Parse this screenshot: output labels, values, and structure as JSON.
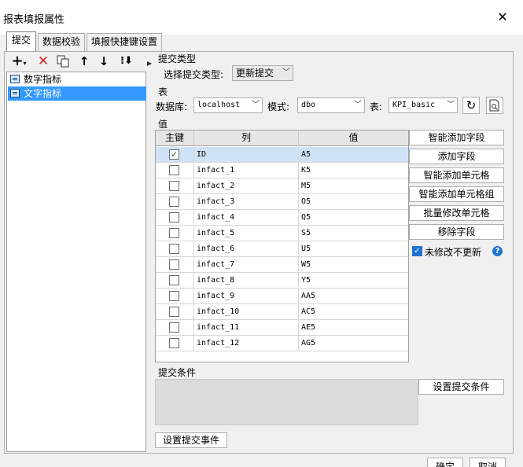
{
  "window": {
    "title": "报表填报属性"
  },
  "tabs": [
    {
      "label": "提交",
      "active": true
    },
    {
      "label": "数据校验",
      "active": false
    },
    {
      "label": "填报快捷键设置",
      "active": false
    }
  ],
  "left_toolbar": {
    "icons": [
      "add-icon",
      "delete-icon",
      "copy-icon",
      "move-up-icon",
      "move-down-icon",
      "sort-icon"
    ]
  },
  "tree": {
    "items": [
      {
        "label": "数字指标",
        "selected": false
      },
      {
        "label": "文字指标",
        "selected": true
      }
    ]
  },
  "submit_type": {
    "section_label": "提交类型",
    "field_label": "选择提交类型:",
    "value": "更新提交"
  },
  "table_section": {
    "section_label": "表",
    "db_label": "数据库:",
    "db_value": "localhost",
    "schema_label": "模式:",
    "schema_value": "dbo",
    "table_label": "表:",
    "table_value": "KPI_basic"
  },
  "value_section": {
    "section_label": "值",
    "headers": {
      "key": "主键",
      "column": "列",
      "value": "值"
    },
    "rows": [
      {
        "key": true,
        "column": "ID",
        "value": "A5",
        "selected": true
      },
      {
        "key": false,
        "column": "infact_1",
        "value": "K5"
      },
      {
        "key": false,
        "column": "infact_2",
        "value": "M5"
      },
      {
        "key": false,
        "column": "infact_3",
        "value": "O5"
      },
      {
        "key": false,
        "column": "infact_4",
        "value": "Q5"
      },
      {
        "key": false,
        "column": "infact_5",
        "value": "S5"
      },
      {
        "key": false,
        "column": "infact_6",
        "value": "U5"
      },
      {
        "key": false,
        "column": "infact_7",
        "value": "W5"
      },
      {
        "key": false,
        "column": "infact_8",
        "value": "Y5"
      },
      {
        "key": false,
        "column": "infact_9",
        "value": "AA5"
      },
      {
        "key": false,
        "column": "infact_10",
        "value": "AC5"
      },
      {
        "key": false,
        "column": "infact_11",
        "value": "AE5"
      },
      {
        "key": false,
        "column": "infact_12",
        "value": "AG5"
      }
    ]
  },
  "side_buttons": {
    "smart_add_field": "智能添加字段",
    "add_field": "添加字段",
    "smart_add_cell": "智能添加单元格",
    "smart_add_cell_group": "智能添加单元格组",
    "batch_modify_cell": "批量修改单元格",
    "remove_field": "移除字段",
    "no_update_unmodified": "未修改不更新",
    "help": "?"
  },
  "condition": {
    "section_label": "提交条件",
    "set_condition_button": "设置提交条件"
  },
  "event_button": "设置提交事件",
  "footer": {
    "ok": "确定",
    "cancel": "取消"
  },
  "colors": {
    "accent": "#1f74d1",
    "selection": "#3399ff",
    "row_selected": "#cfe3f6"
  }
}
